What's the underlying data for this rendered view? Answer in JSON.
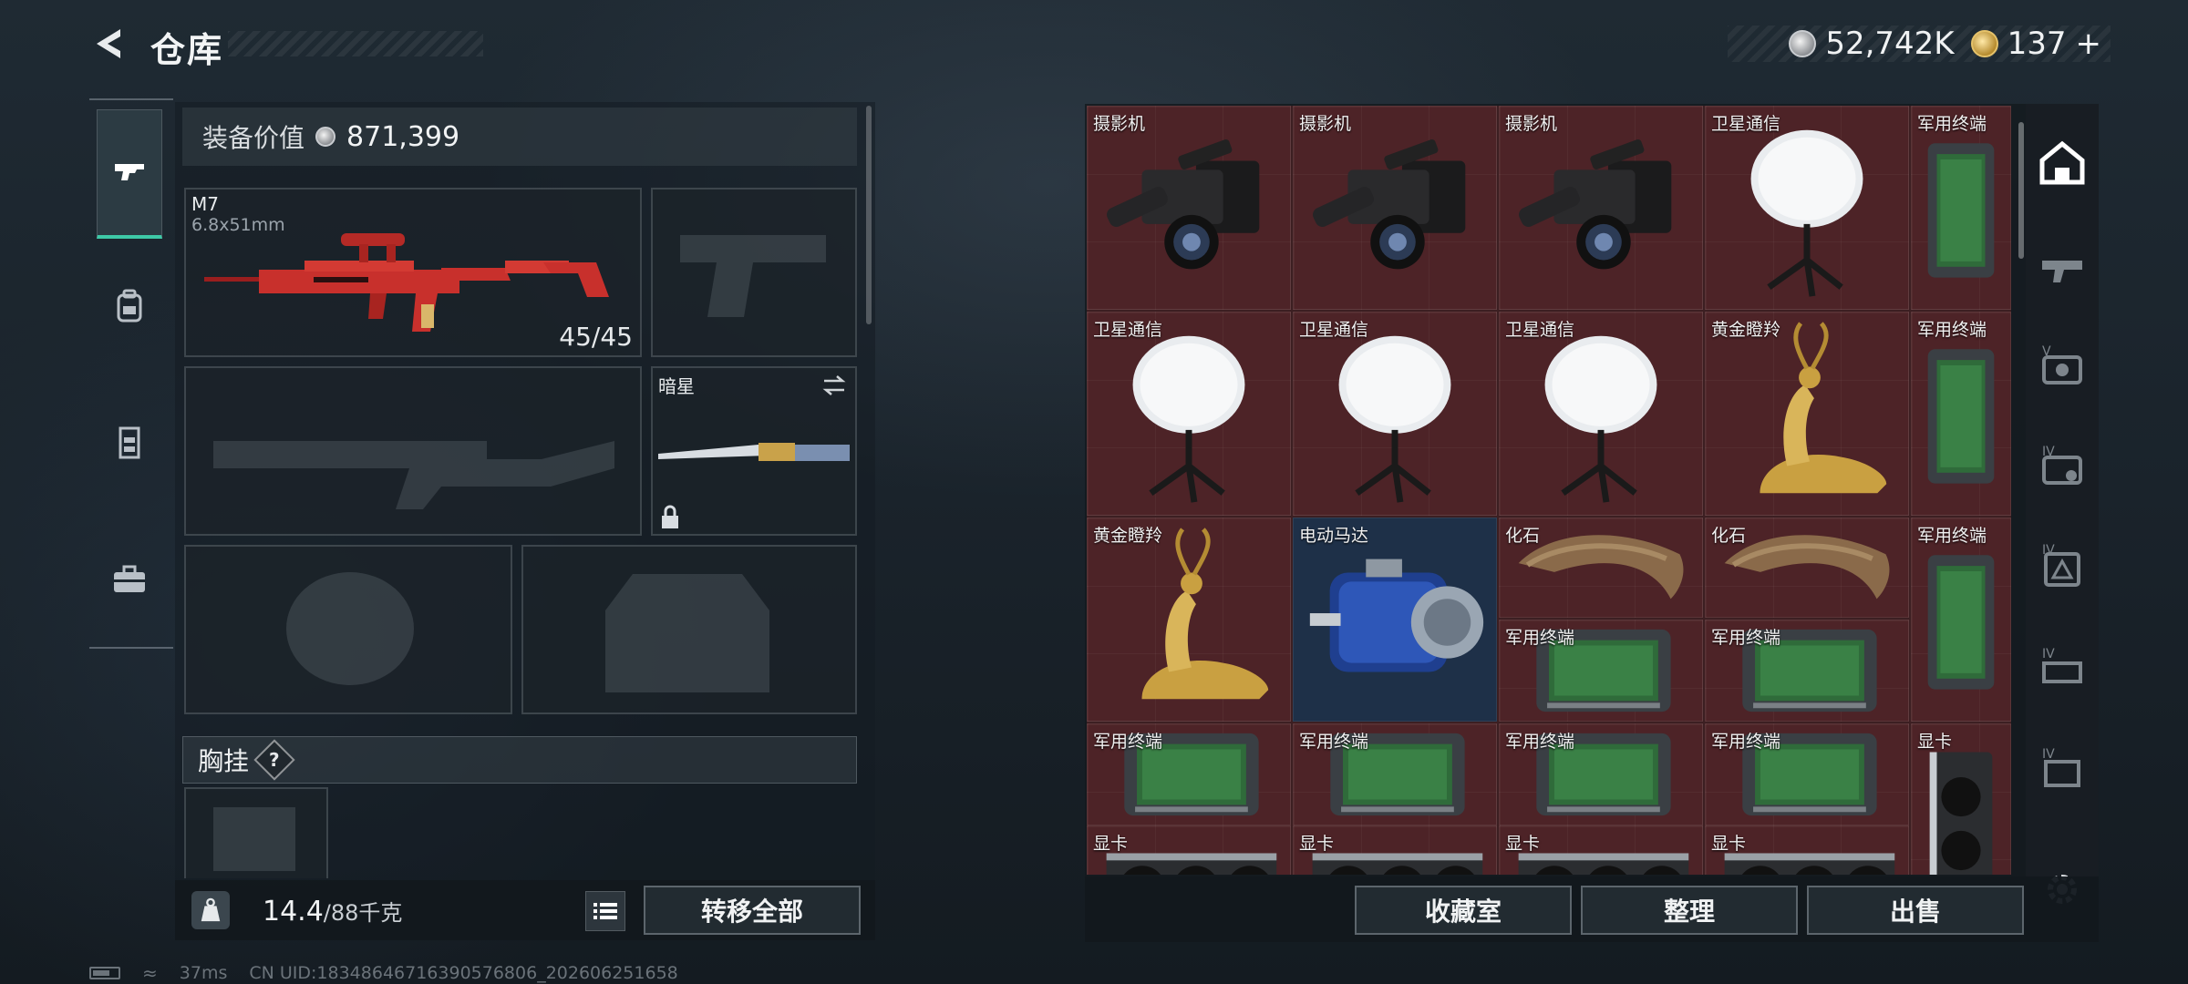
{
  "header": {
    "title": "仓库",
    "currency_silver": "52,742K",
    "currency_gold": "137",
    "currency_gold_plus": "+"
  },
  "side_tabs": [
    "gun-icon",
    "backpack-icon",
    "vest-icon",
    "briefcase-icon"
  ],
  "loadout": {
    "value_label": "装备价值",
    "value_amount": "871,399",
    "primary_weapon": {
      "name": "M7",
      "caliber": "6.8x51mm",
      "ammo": "45/45"
    },
    "melee": {
      "name": "暗星",
      "locked": true
    },
    "chest_rig_label": "胸挂",
    "chest_rig_help": "?",
    "weight_current": "14.4",
    "weight_max": "/88千克",
    "transfer_all": "转移全部"
  },
  "inventory": {
    "items": [
      {
        "name": "摄影机"
      },
      {
        "name": "摄影机"
      },
      {
        "name": "摄影机"
      },
      {
        "name": "卫星通信"
      },
      {
        "name": "军用终端"
      },
      {
        "name": "卫星通信"
      },
      {
        "name": "卫星通信"
      },
      {
        "name": "卫星通信"
      },
      {
        "name": "黄金瞪羚"
      },
      {
        "name": "军用终端"
      },
      {
        "name": "黄金瞪羚"
      },
      {
        "name": "电动马达"
      },
      {
        "name": "化石"
      },
      {
        "name": "化石"
      },
      {
        "name": "军用终端"
      },
      {
        "name": "军用终端"
      },
      {
        "name": "军用终端"
      },
      {
        "name": "军用终端"
      },
      {
        "name": "军用终端"
      },
      {
        "name": "军用终端"
      },
      {
        "name": "军用终端"
      },
      {
        "name": "显卡"
      },
      {
        "name": "显卡"
      },
      {
        "name": "显卡"
      },
      {
        "name": "显卡"
      },
      {
        "name": "显卡"
      }
    ],
    "category_labels": [
      "",
      "",
      "V",
      "IV",
      "IV",
      "IV",
      "IV"
    ],
    "btn_collection": "收藏室",
    "btn_sort": "整理",
    "btn_sell": "出售"
  },
  "status": {
    "ping": "37ms",
    "uid": "CN UID:18348646716390576806_202606251658"
  }
}
